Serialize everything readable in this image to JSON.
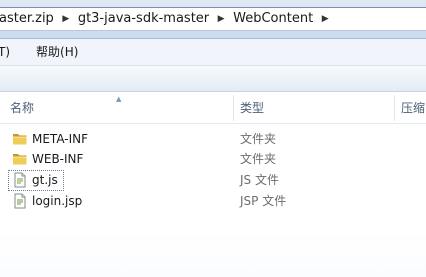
{
  "address_bar": {
    "crumbs": [
      "aster.zip",
      "gt3-java-sdk-master",
      "WebContent"
    ],
    "separator_icon": "chevron-right-icon"
  },
  "menu": {
    "items": [
      "T)",
      "帮助(H)"
    ]
  },
  "columns": {
    "name": "名称",
    "type": "类型",
    "size": "压缩"
  },
  "files": [
    {
      "name": "META-INF",
      "type": "文件夹",
      "icon": "folder-icon"
    },
    {
      "name": "WEB-INF",
      "type": "文件夹",
      "icon": "folder-icon"
    },
    {
      "name": "gt.js",
      "type": "JS 文件",
      "icon": "js-file-icon"
    },
    {
      "name": "login.jsp",
      "type": "JSP 文件",
      "icon": "jsp-file-icon"
    }
  ],
  "colors": {
    "folder": "#e8c34a",
    "folder_dark": "#c99a1f",
    "header_text": "#4c607a"
  }
}
